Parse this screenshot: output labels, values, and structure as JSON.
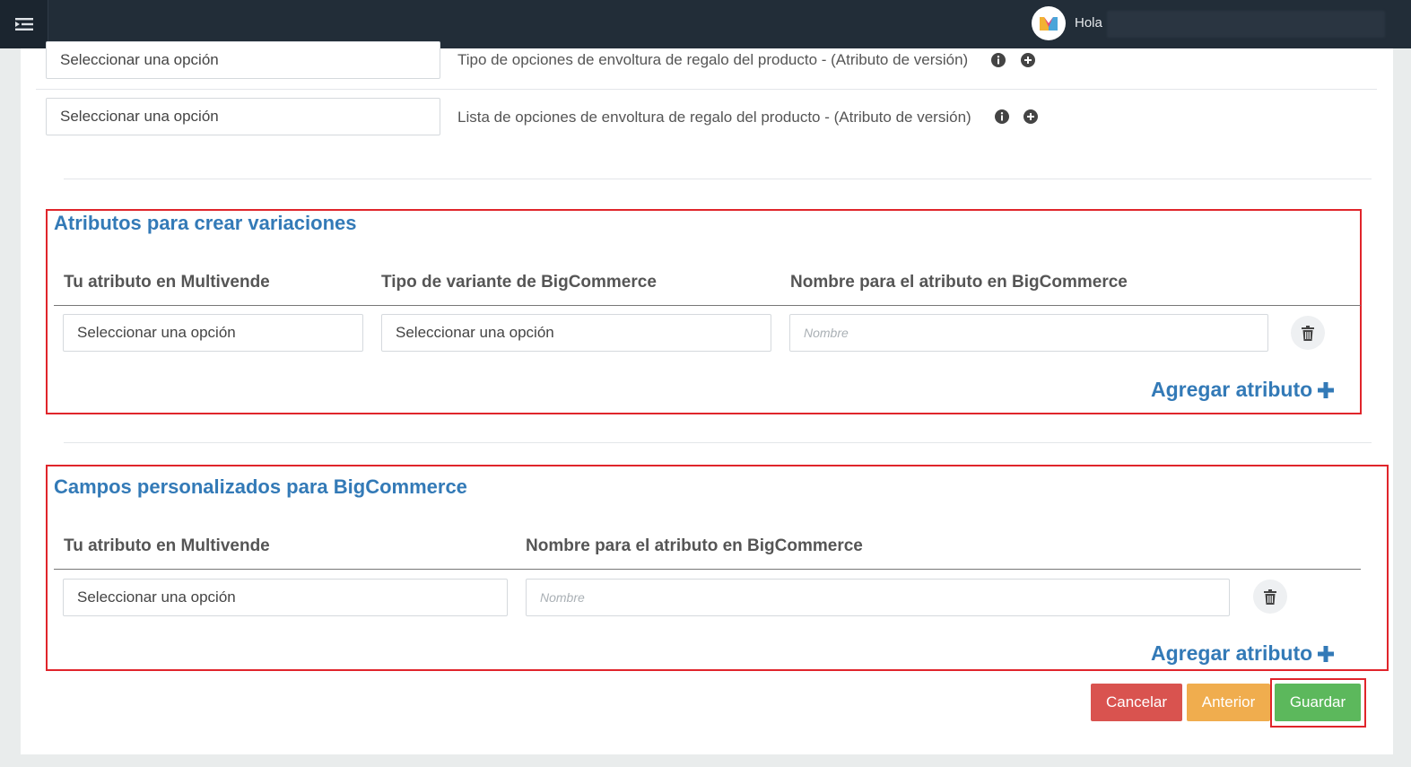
{
  "topbar": {
    "greeting": "Hola"
  },
  "top_rows": [
    {
      "select_value": "Seleccionar una opción",
      "label": "Tipo de opciones de envoltura de regalo del producto - (Atributo de versión)"
    },
    {
      "select_value": "Seleccionar una opción",
      "label": "Lista de opciones de envoltura de regalo del producto - (Atributo de versión)"
    }
  ],
  "variations": {
    "title": "Atributos para crear variaciones",
    "headers": [
      "Tu atributo en Multivende",
      "Tipo de variante de BigCommerce",
      "Nombre para el atributo en BigCommerce"
    ],
    "row": {
      "attribute_select": "Seleccionar una opción",
      "variant_select": "Seleccionar una opción",
      "name_placeholder": "Nombre"
    },
    "add_label": "Agregar atributo"
  },
  "custom_fields": {
    "title": "Campos personalizados para BigCommerce",
    "headers": [
      "Tu atributo en Multivende",
      "Nombre para el atributo en BigCommerce"
    ],
    "row": {
      "attribute_select": "Seleccionar una opción",
      "name_placeholder": "Nombre"
    },
    "add_label": "Agregar atributo"
  },
  "actions": {
    "cancel": "Cancelar",
    "previous": "Anterior",
    "save": "Guardar"
  },
  "colors": {
    "topbar": "#222d38",
    "accent": "#337ab7",
    "highlight": "#e0252b",
    "cancel": "#d9534f",
    "previous": "#f0ad4e",
    "save": "#5cb85c"
  },
  "icons": {
    "menu": "menu-collapse-icon",
    "info": "info-circle-icon",
    "add": "plus-circle-icon",
    "delete": "trash-icon",
    "plus": "plus-icon"
  }
}
